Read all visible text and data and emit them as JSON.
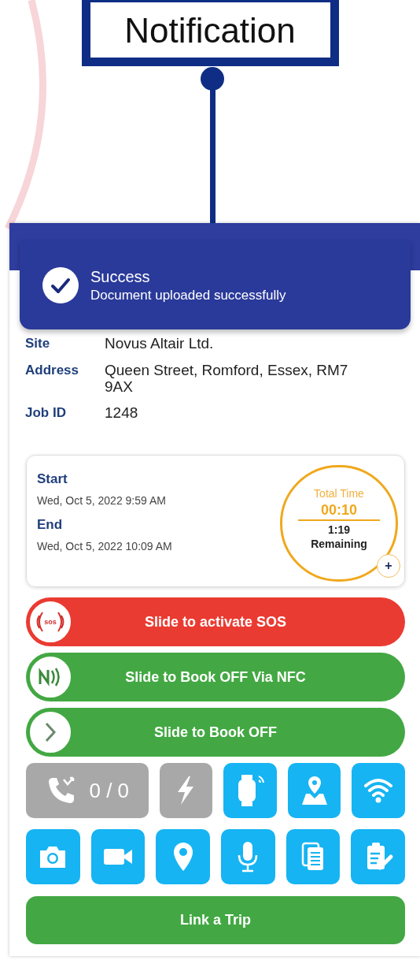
{
  "callout": {
    "label": "Notification"
  },
  "toast": {
    "title": "Success",
    "message": "Document uploaded successfully"
  },
  "details": [
    {
      "label": "Site",
      "value": "Novus Altair Ltd."
    },
    {
      "label": "Address",
      "value": "Queen Street, Romford, Essex, RM7 9AX"
    },
    {
      "label": "Job ID",
      "value": "1248"
    }
  ],
  "times": [
    {
      "label": "Start",
      "value": "Wed, Oct 5, 2022 9:59 AM"
    },
    {
      "label": "End",
      "value": "Wed, Oct 5, 2022 10:09 AM"
    }
  ],
  "timer": {
    "title": "Total Time",
    "elapsed": "00:10",
    "remaining": "1:19",
    "remaining_label": "Remaining",
    "add": "+"
  },
  "sliders": [
    {
      "kind": "sos",
      "label": "Slide to activate SOS",
      "knob_text": "sos"
    },
    {
      "kind": "nfc",
      "label": "Slide to Book OFF Via NFC"
    },
    {
      "kind": "arrow",
      "label": "Slide to Book OFF"
    }
  ],
  "tiles": [
    [
      {
        "kind": "call",
        "disabled": true,
        "text": "0 / 0"
      },
      {
        "kind": "bolt",
        "disabled": true
      },
      {
        "kind": "watch",
        "disabled": false
      },
      {
        "kind": "map",
        "disabled": false
      },
      {
        "kind": "wifi",
        "disabled": false
      }
    ],
    [
      {
        "kind": "camera",
        "disabled": false
      },
      {
        "kind": "video",
        "disabled": false
      },
      {
        "kind": "pin",
        "disabled": false
      },
      {
        "kind": "mic",
        "disabled": false
      },
      {
        "kind": "docs",
        "disabled": false
      },
      {
        "kind": "clipboard",
        "disabled": false
      }
    ]
  ],
  "link_button": "Link a Trip"
}
